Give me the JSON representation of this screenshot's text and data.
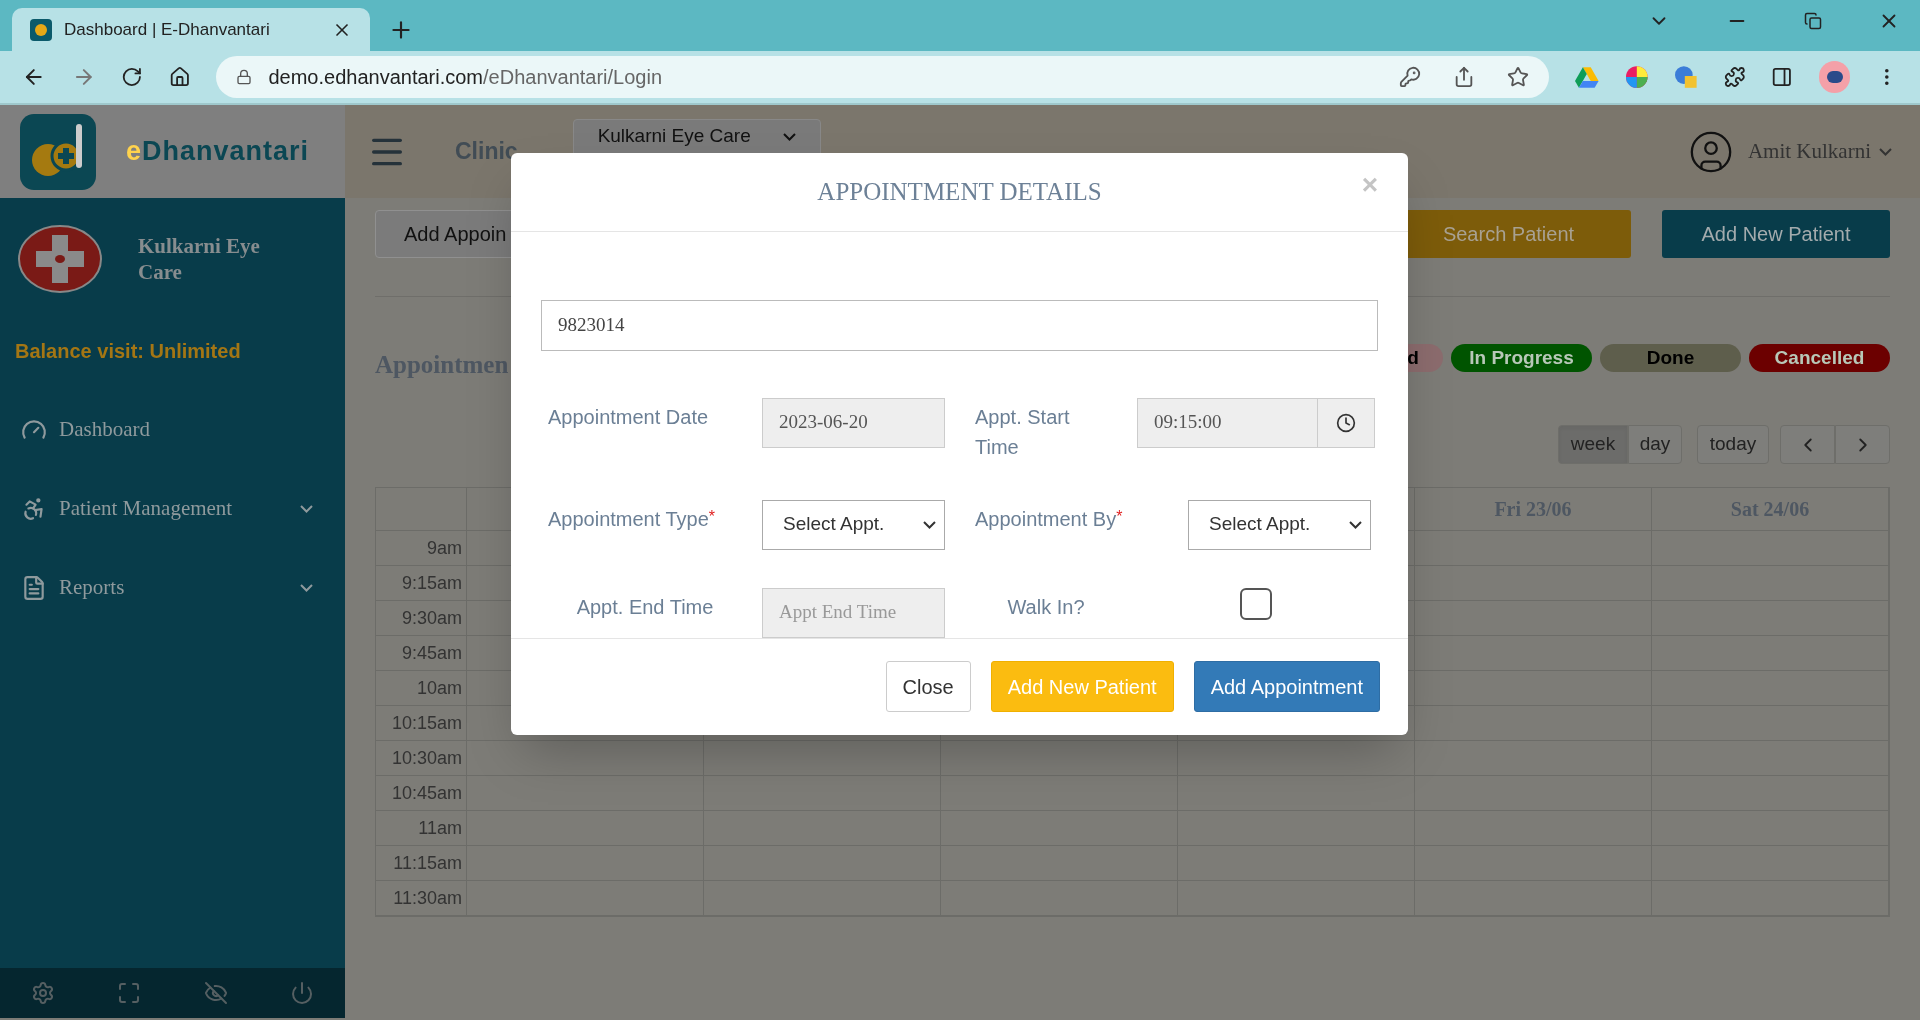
{
  "browser": {
    "tab_title": "Dashboard | E-Dhanvantari",
    "url_host": "demo.edhanvantari.com",
    "url_path": "/eDhanvantari/Login"
  },
  "sidebar": {
    "brand": {
      "lead": "e",
      "rest": "Dhanvantari"
    },
    "clinic_name": "Kulkarni Eye Care",
    "balance": "Balance visit: Unlimited",
    "items": [
      {
        "label": "Dashboard",
        "kind": "link"
      },
      {
        "label": "Patient Management",
        "kind": "group"
      },
      {
        "label": "Reports",
        "kind": "group"
      }
    ]
  },
  "header": {
    "clinic_label": "Clinic",
    "clinic_select": "Kulkarni Eye Care",
    "user": "Amit Kulkarni"
  },
  "toolbar": {
    "add_button": "Add Appoin",
    "search_button": "Search Patient",
    "new_patient_button": "Add New Patient"
  },
  "heading": "Appointmen",
  "legend": [
    {
      "label": "d",
      "color": "#8c6c6e",
      "kind": "dark"
    },
    {
      "label": "In Progress",
      "color": "#005400",
      "kind": "light"
    },
    {
      "label": "Done",
      "color": "#5e5e4c",
      "kind": "dark"
    },
    {
      "label": "Cancelled",
      "color": "#6c0000",
      "kind": "light"
    }
  ],
  "view_buttons": [
    {
      "label": "week",
      "selected": true
    },
    {
      "label": "day",
      "selected": false
    }
  ],
  "today_button": "today",
  "calendar": {
    "day_headers": [
      "Fri 23/06",
      "Sat 24/06"
    ],
    "times": [
      "9am",
      "9:15am",
      "9:30am",
      "9:45am",
      "10am",
      "10:15am",
      "10:30am",
      "10:45am",
      "11am",
      "11:15am",
      "11:30am"
    ]
  },
  "modal": {
    "title": "APPOINTMENT DETAILS",
    "close": "×",
    "patient_field": "9823014",
    "required_mark": "*",
    "fields": [
      {
        "label": "Appointment Date",
        "kind": "readonly",
        "value": "2023-06-20",
        "required": false
      },
      {
        "label": "Appt. Start Time",
        "kind": "time",
        "value": "09:15:00",
        "required": false
      },
      {
        "label": "Appointment Type",
        "kind": "select",
        "value": "Select Appt.",
        "required": true
      },
      {
        "label": "Appointment By",
        "kind": "select",
        "value": "Select Appt.",
        "required": true
      },
      {
        "label": "Appt. End Time",
        "kind": "readonly",
        "placeholder": "Appt End Time",
        "required": false
      },
      {
        "label": "Walk In?",
        "kind": "checkbox",
        "checked": false,
        "required": false
      }
    ],
    "buttons": [
      {
        "label": "Close",
        "kind": "default"
      },
      {
        "label": "Add New Patient",
        "kind": "warning"
      },
      {
        "label": "Add Appointment",
        "kind": "primary"
      }
    ]
  }
}
